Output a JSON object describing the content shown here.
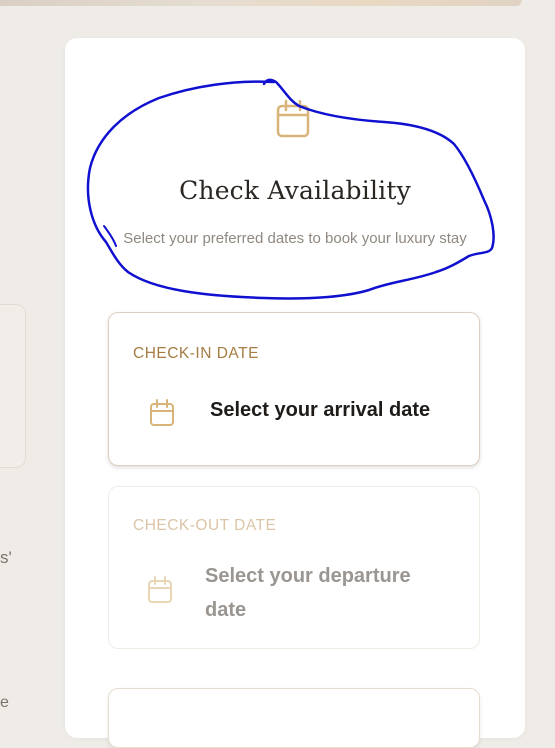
{
  "availability": {
    "title": "Check Availability",
    "subtitle": "Select your preferred dates to book your luxury stay",
    "icon": "calendar-icon"
  },
  "check_in": {
    "label": "CHECK-IN DATE",
    "value": "Select your arrival date",
    "icon": "calendar-icon"
  },
  "check_out": {
    "label": "CHECK-OUT DATE",
    "value": "Select your departure date",
    "icon": "calendar-icon"
  },
  "background": {
    "left_quote": "s'",
    "left_text": "e"
  },
  "colors": {
    "accent": "#a57c43",
    "accent_light": "#dbc5a6",
    "icon_gold": "#d9b47a",
    "annotation": "#1010d0"
  }
}
